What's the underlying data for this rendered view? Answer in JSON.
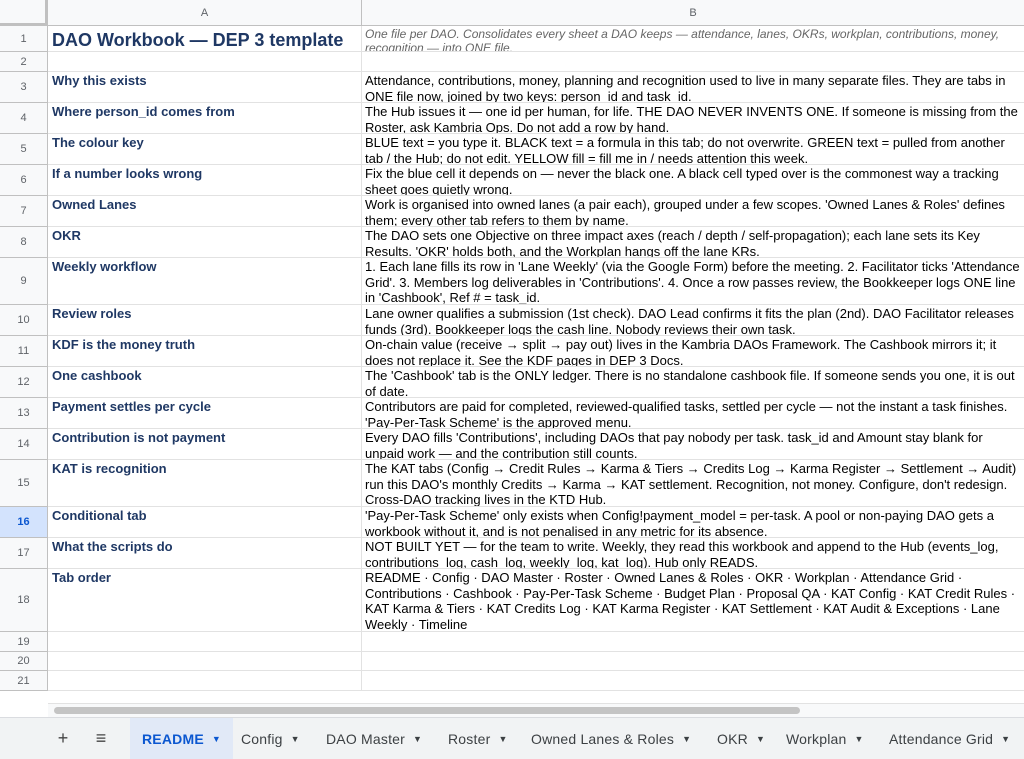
{
  "columns": [
    "A",
    "B"
  ],
  "rows": [
    {
      "n": "1",
      "a": "DAO Workbook — DEP 3 template",
      "b": "One file per DAO. Consolidates every sheet a DAO keeps — attendance, lanes, OKRs, workplan, contributions, money, recognition — into ONE file."
    },
    {
      "n": "2",
      "a": "",
      "b": ""
    },
    {
      "n": "3",
      "a": "Why this exists",
      "b": "Attendance, contributions, money, planning and recognition used to live in many separate files. They are tabs in ONE file now, joined by two keys: person_id and task_id."
    },
    {
      "n": "4",
      "a": "Where person_id comes from",
      "b": "The Hub issues it — one id per human, for life. THE DAO NEVER INVENTS ONE. If someone is missing from the Roster, ask Kambria Ops. Do not add a row by hand."
    },
    {
      "n": "5",
      "a": "The colour key",
      "b": "BLUE text = you type it.  BLACK text = a formula in this tab; do not overwrite.  GREEN text = pulled from another tab / the Hub; do not edit.  YELLOW fill = fill me in / needs attention this week."
    },
    {
      "n": "6",
      "a": "If a number looks wrong",
      "b": "Fix the blue cell it depends on — never the black one. A black cell typed over is the commonest way a tracking sheet goes quietly wrong."
    },
    {
      "n": "7",
      "a": "Owned Lanes",
      "b": "Work is organised into owned lanes (a pair each), grouped under a few scopes. 'Owned Lanes & Roles' defines them; every other tab refers to them by name."
    },
    {
      "n": "8",
      "a": "OKR",
      "b": "The DAO sets one Objective on three impact axes (reach / depth / self-propagation); each lane sets its Key Results. 'OKR' holds both, and the Workplan hangs off the lane KRs."
    },
    {
      "n": "9",
      "a": "Weekly workflow",
      "b": "1. Each lane fills its row in 'Lane Weekly' (via the Google Form) before the meeting. 2. Facilitator ticks 'Attendance Grid'. 3. Members log deliverables in 'Contributions'. 4. Once a row passes review, the Bookkeeper logs ONE line in 'Cashbook', Ref # = task_id."
    },
    {
      "n": "10",
      "a": "Review roles",
      "b": "Lane owner qualifies a submission (1st check). DAO Lead confirms it fits the plan (2nd). DAO Facilitator releases funds (3rd). Bookkeeper logs the cash line. Nobody reviews their own task."
    },
    {
      "n": "11",
      "a": "KDF is the money truth",
      "b": "On-chain value (receive → split → pay out) lives in the Kambria DAOs Framework. The Cashbook mirrors it; it does not replace it. See the KDF pages in DEP 3 Docs."
    },
    {
      "n": "12",
      "a": "One cashbook",
      "b": "The 'Cashbook' tab is the ONLY ledger. There is no standalone cashbook file. If someone sends you one, it is out of date."
    },
    {
      "n": "13",
      "a": "Payment settles per cycle",
      "b": "Contributors are paid for completed, reviewed-qualified tasks, settled per cycle — not the instant a task finishes. 'Pay-Per-Task Scheme' is the approved menu."
    },
    {
      "n": "14",
      "a": "Contribution is not payment",
      "b": "Every DAO fills 'Contributions', including DAOs that pay nobody per task. task_id and Amount stay blank for unpaid work — and the contribution still counts."
    },
    {
      "n": "15",
      "a": "KAT is recognition",
      "b": "The KAT tabs (Config → Credit Rules → Karma & Tiers → Credits Log → Karma Register → Settlement → Audit) run this DAO's monthly Credits → Karma → KAT settlement. Recognition, not money. Configure, don't redesign. Cross-DAO tracking lives in the KTD Hub."
    },
    {
      "n": "16",
      "a": "Conditional tab",
      "b": "'Pay-Per-Task Scheme' only exists when Config!payment_model = per-task. A pool or non-paying DAO gets a workbook without it, and is not penalised in any metric for its absence."
    },
    {
      "n": "17",
      "a": "What the scripts do",
      "b": "NOT BUILT YET — for the team to write. Weekly, they read this workbook and append to the Hub (events_log, contributions_log, cash_log, weekly_log, kat_log). Hub only READS."
    },
    {
      "n": "18",
      "a": "Tab order",
      "b": "README · Config · DAO Master · Roster · Owned Lanes & Roles · OKR · Workplan · Attendance Grid · Contributions · Cashbook · Pay-Per-Task Scheme · Budget Plan · Proposal QA · KAT Config · KAT Credit Rules · KAT Karma & Tiers · KAT Credits Log · KAT Karma Register · KAT Settlement · KAT Audit & Exceptions · Lane Weekly · Timeline"
    },
    {
      "n": "19",
      "a": "",
      "b": ""
    },
    {
      "n": "20",
      "a": "",
      "b": ""
    },
    {
      "n": "21",
      "a": "",
      "b": ""
    }
  ],
  "selected_row": "16",
  "toolbar": {
    "add_sheet": "+",
    "all_sheets": "≡"
  },
  "tabs": [
    {
      "label": "README",
      "active": true
    },
    {
      "label": "Config",
      "active": false
    },
    {
      "label": "DAO Master",
      "active": false
    },
    {
      "label": "Roster",
      "active": false
    },
    {
      "label": "Owned Lanes & Roles",
      "active": false
    },
    {
      "label": "OKR",
      "active": false
    },
    {
      "label": "Workplan",
      "active": false
    },
    {
      "label": "Attendance Grid",
      "active": false
    }
  ],
  "colors": {
    "label_text": "#1f3864",
    "active_tab": "#0b57d0",
    "selected_row_bg": "#d3e3fd"
  }
}
